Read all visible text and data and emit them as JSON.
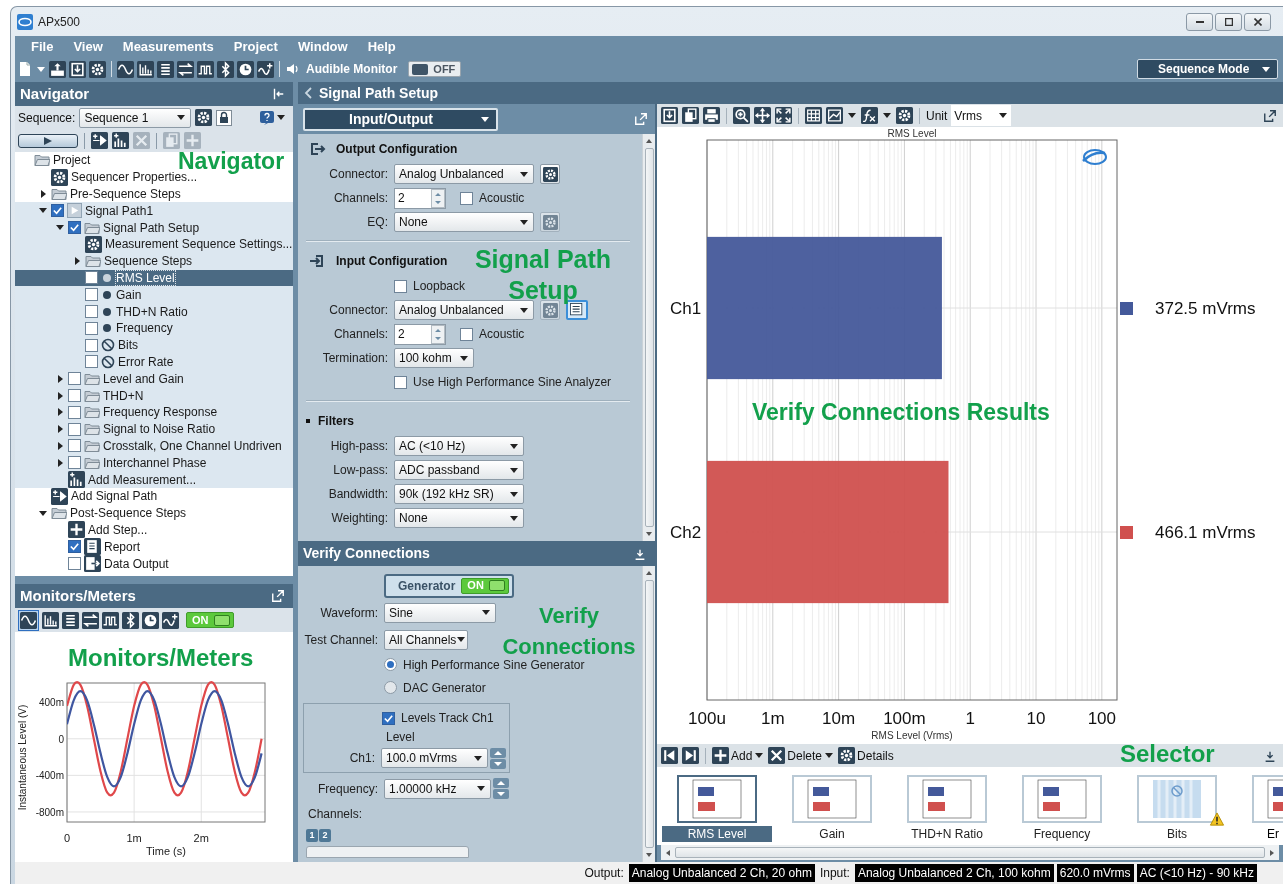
{
  "window": {
    "title": "APx500"
  },
  "menu": [
    "File",
    "View",
    "Measurements",
    "Project",
    "Window",
    "Help"
  ],
  "toolbar": {
    "audible_monitor": {
      "label": "Audible Monitor",
      "toggle": "OFF",
      "on": false
    },
    "mode": "Sequence Mode"
  },
  "navigator": {
    "title": "Navigator",
    "callout": "Navigator",
    "sequence_label": "Sequence:",
    "sequence": "Sequence 1",
    "tree": [
      {
        "label": "Project",
        "kind": "folder",
        "selected": false,
        "children": [
          {
            "label": "Sequencer Properties...",
            "kind": "settings",
            "selected": false
          },
          {
            "label": "Pre-Sequence Steps",
            "kind": "folder",
            "selected": false,
            "expanded": false
          },
          {
            "label": "Signal Path1",
            "kind": "signal",
            "selected": false,
            "checked": true,
            "expanded": true,
            "children": [
              {
                "label": "Signal Path Setup",
                "kind": "folder",
                "selected": false,
                "checked": true,
                "expanded": true,
                "children": [
                  {
                    "label": "Measurement Sequence Settings...",
                    "kind": "settings",
                    "selected": false
                  },
                  {
                    "label": "Sequence Steps",
                    "kind": "folder",
                    "selected": false,
                    "expanded": false
                  },
                  {
                    "label": "RMS Level",
                    "kind": "measurement",
                    "selected": true,
                    "checked": false
                  },
                  {
                    "label": "Gain",
                    "kind": "measurement",
                    "selected": false,
                    "checked": false
                  },
                  {
                    "label": "THD+N Ratio",
                    "kind": "measurement",
                    "selected": false,
                    "checked": false
                  },
                  {
                    "label": "Frequency",
                    "kind": "measurement",
                    "selected": false,
                    "checked": false
                  },
                  {
                    "label": "Bits",
                    "kind": "unavailable",
                    "selected": false,
                    "checked": false
                  },
                  {
                    "label": "Error Rate",
                    "kind": "unavailable",
                    "selected": false,
                    "checked": false
                  }
                ]
              },
              {
                "label": "Level and Gain",
                "kind": "folder",
                "selected": false,
                "checked": false,
                "expanded": false
              },
              {
                "label": "THD+N",
                "kind": "folder",
                "selected": false,
                "checked": false,
                "expanded": false
              },
              {
                "label": "Frequency Response",
                "kind": "folder",
                "selected": false,
                "checked": false,
                "expanded": false
              },
              {
                "label": "Signal to Noise Ratio",
                "kind": "folder",
                "selected": false,
                "checked": false,
                "expanded": false
              },
              {
                "label": "Crosstalk, One Channel Undriven",
                "kind": "folder",
                "selected": false,
                "checked": false,
                "expanded": false
              },
              {
                "label": "Interchannel Phase",
                "kind": "folder",
                "selected": false,
                "checked": false,
                "expanded": false
              },
              {
                "label": "Add Measurement...",
                "kind": "add-measurement",
                "selected": false
              }
            ]
          },
          {
            "label": "Add Signal Path",
            "kind": "add-path",
            "selected": false
          },
          {
            "label": "Post-Sequence Steps",
            "kind": "folder",
            "selected": false,
            "expanded": true,
            "children": [
              {
                "label": "Add Step...",
                "kind": "add",
                "selected": false
              },
              {
                "label": "Report",
                "kind": "report",
                "selected": false,
                "checked": true
              },
              {
                "label": "Data Output",
                "kind": "output",
                "selected": false,
                "checked": false
              }
            ]
          }
        ]
      }
    ]
  },
  "monitors": {
    "title": "Monitors/Meters",
    "callout": "Monitors/Meters",
    "toggle": {
      "label": "ON",
      "on": true
    },
    "chart_data": {
      "type": "line",
      "grid": true,
      "xlabel": "Time (s)",
      "ylabel": "Instantaneous Level (V)",
      "x": [
        0,
        0.1,
        0.2,
        0.3,
        0.4,
        0.5,
        0.6,
        0.7,
        0.8,
        0.9,
        1,
        1.1,
        1.2,
        1.3,
        1.4,
        1.5,
        1.6,
        1.7,
        1.8,
        1.9,
        2,
        2.1,
        2.2,
        2.3,
        2.4,
        2.5,
        2.6,
        2.7,
        2.8,
        2.9
      ],
      "series": [
        {
          "color": "#e0484a",
          "values": [
            360,
            590,
            590,
            360,
            0,
            -360,
            -590,
            -590,
            -360,
            0,
            360,
            590,
            590,
            360,
            0,
            -360,
            -590,
            -590,
            -360,
            0,
            360,
            590,
            590,
            360,
            0,
            -360,
            -590,
            -590,
            -360,
            0
          ]
        },
        {
          "color": "#3f56a0",
          "values": [
            160,
            420,
            520,
            420,
            160,
            -160,
            -420,
            -520,
            -420,
            -160,
            160,
            420,
            520,
            420,
            160,
            -160,
            -420,
            -520,
            -420,
            -160,
            160,
            420,
            520,
            420,
            160,
            -160,
            -420,
            -520,
            -420,
            -160
          ]
        }
      ],
      "xlim": [
        0,
        2.95
      ],
      "ylim": [
        -910,
        610
      ],
      "xticks": [
        {
          "value": 0,
          "label": "0"
        },
        {
          "value": 1,
          "label": "1m"
        },
        {
          "value": 2,
          "label": "2m"
        }
      ],
      "yticks": [
        {
          "value": 400,
          "label": "400m"
        },
        {
          "value": 0,
          "label": "0"
        },
        {
          "value": -400,
          "label": "-400m"
        },
        {
          "value": -800,
          "label": "-800m"
        }
      ]
    }
  },
  "signal_path_setup": {
    "title": "Signal Path Setup",
    "page": "Input/Output",
    "callout": "Signal Path Setup",
    "sections": [
      {
        "title": "Output Configuration",
        "kind": "output",
        "fields": [
          {
            "kind": "select",
            "label": "Connector:",
            "value": "Analog Unbalanced",
            "extras": [
              {
                "kind": "settings",
                "disabled": false
              }
            ]
          },
          {
            "kind": "spinner",
            "label": "Channels:",
            "value": "2",
            "check": {
              "label": "Acoustic",
              "checked": false
            }
          },
          {
            "kind": "select",
            "label": "EQ:",
            "value": "None",
            "extras": [
              {
                "kind": "settings",
                "disabled": true
              }
            ]
          }
        ]
      },
      {
        "title": "Input Configuration",
        "kind": "input",
        "fields": [
          {
            "kind": "checkbox",
            "label": "Loopback",
            "checked": false
          },
          {
            "kind": "select",
            "label": "Connector:",
            "value": "Analog Unbalanced",
            "extras": [
              {
                "kind": "settings",
                "disabled": true
              },
              {
                "kind": "panel",
                "disabled": false
              }
            ]
          },
          {
            "kind": "spinner",
            "label": "Channels:",
            "value": "2",
            "check": {
              "label": "Acoustic",
              "checked": false
            }
          },
          {
            "kind": "compact-select",
            "label": "Termination:",
            "value": "100 kohm"
          },
          {
            "kind": "checkbox",
            "label": "Use High Performance Sine Analyzer",
            "checked": false
          }
        ]
      },
      {
        "title": "Filters",
        "kind": "filters",
        "fields": [
          {
            "kind": "select",
            "label": "High-pass:",
            "value": "AC (<10 Hz)"
          },
          {
            "kind": "select",
            "label": "Low-pass:",
            "value": "ADC passband"
          },
          {
            "kind": "select",
            "label": "Bandwidth:",
            "value": "90k (192 kHz SR)"
          },
          {
            "kind": "select",
            "label": "Weighting:",
            "value": "None"
          }
        ]
      }
    ]
  },
  "verify_connections": {
    "title": "Verify Connections",
    "callout": "Verify Connections",
    "generator": {
      "label": "Generator",
      "toggle": "ON",
      "on": true
    },
    "waveform": {
      "label": "Waveform:",
      "value": "Sine"
    },
    "test_channel": {
      "label": "Test Channel:",
      "value": "All Channels"
    },
    "generators": [
      {
        "label": "High Performance Sine Generator",
        "selected": true
      },
      {
        "label": "DAC Generator",
        "selected": false
      }
    ],
    "levels_track": {
      "label": "Levels Track Ch1",
      "checked": true
    },
    "level_heading": "Level",
    "ch1": {
      "label": "Ch1:",
      "value": "100.0 mVrms"
    },
    "frequency": {
      "label": "Frequency:",
      "value": "1.00000 kHz"
    },
    "channels_label": "Channels:",
    "channel_buttons": [
      "1",
      "2"
    ]
  },
  "results": {
    "unit_label": "Unit",
    "unit": "Vrms",
    "callout": "Verify Connections Results",
    "title": "RMS Level",
    "axis_title": "RMS Level (Vrms)",
    "scale_labels": [
      "100u",
      "1m",
      "10m",
      "100m",
      "1",
      "10",
      "100"
    ],
    "channels": [
      {
        "label": "Ch1",
        "color": "#44599a",
        "reading": "372.5 mVrms"
      },
      {
        "label": "Ch2",
        "color": "#d0504e",
        "reading": "466.1 mVrms"
      }
    ]
  },
  "selector": {
    "callout": "Selector",
    "actions": [
      {
        "label": "Add",
        "kind": "add"
      },
      {
        "label": "Delete",
        "kind": "delete"
      },
      {
        "label": "Details",
        "kind": "details"
      }
    ],
    "items": [
      {
        "label": "RMS Level",
        "kind": "bars",
        "selected": true
      },
      {
        "label": "Gain",
        "kind": "bars",
        "selected": false
      },
      {
        "label": "THD+N Ratio",
        "kind": "bars",
        "selected": false
      },
      {
        "label": "Frequency",
        "kind": "bars",
        "selected": false
      },
      {
        "label": "Bits",
        "kind": "unavailable",
        "selected": false,
        "warning": true
      },
      {
        "label": "Er",
        "kind": "bars",
        "selected": false
      }
    ]
  },
  "status_bar": {
    "output_label": "Output:",
    "output": "Analog Unbalanced 2 Ch, 20 ohm",
    "input_label": "Input:",
    "input": "Analog Unbalanced 2 Ch, 100 kohm",
    "reading": "620.0 mVrms",
    "filter": "AC (<10 Hz) - 90 kHz"
  }
}
